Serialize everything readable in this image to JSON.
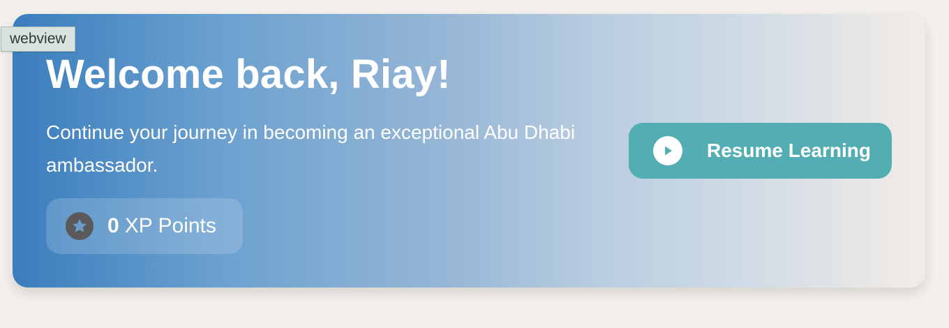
{
  "debug_tag": {
    "label": "webview"
  },
  "hero": {
    "title": "Welcome back, Riay!",
    "subtitle": "Continue your journey in becoming an exceptional Abu Dhabi ambassador.",
    "xp": {
      "value": "0",
      "label": "XP Points",
      "icon": "star-icon"
    },
    "resume_button": {
      "label": "Resume Learning",
      "icon": "play-icon"
    }
  },
  "colors": {
    "gradient_start": "#3a7dbd",
    "gradient_end": "#f0ede9",
    "button_teal": "#52aeb3",
    "star_circle": "#5a5a5a",
    "page_background": "#f3f0ec"
  }
}
